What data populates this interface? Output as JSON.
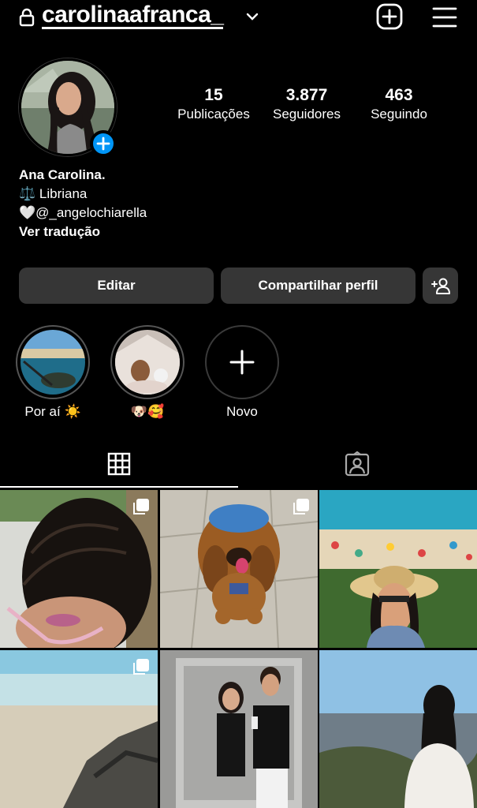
{
  "header": {
    "username": "carolinaafranca_",
    "icons": {
      "lock": "lock-icon",
      "chevron": "chevron-down-icon",
      "create": "plus-square-icon",
      "menu": "hamburger-menu-icon"
    }
  },
  "profile": {
    "stats": [
      {
        "value": "15",
        "label": "Publicações"
      },
      {
        "value": "3.877",
        "label": "Seguidores"
      },
      {
        "value": "463",
        "label": "Seguindo"
      }
    ],
    "bio": {
      "name": "Ana Carolina.",
      "line1": "⚖️ Libriana",
      "line2": "🤍@_angelochiarella",
      "translate": "Ver tradução"
    }
  },
  "actions": {
    "edit": "Editar",
    "share": "Compartilhar perfil"
  },
  "highlights": [
    {
      "label": "Por aí ☀️"
    },
    {
      "label": "🐶🥰"
    },
    {
      "label": "Novo"
    }
  ],
  "colors": {
    "accent": "#0095f6",
    "button_bg": "#363636",
    "background": "#000000"
  }
}
